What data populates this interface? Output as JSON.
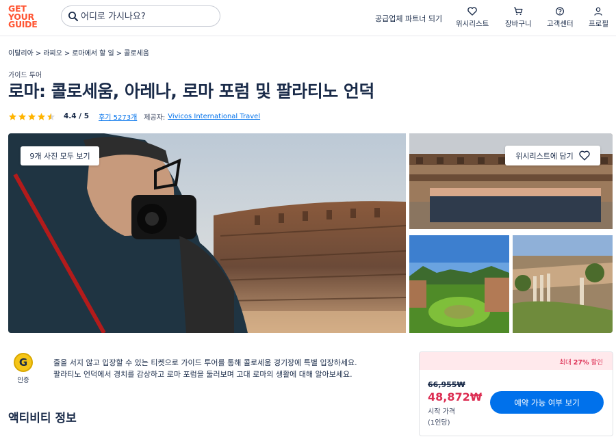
{
  "header": {
    "logo_lines": [
      "GET",
      "YOUR",
      "GUIDE"
    ],
    "search_placeholder": "어디로 가시나요?",
    "partner_link": "공급업체 파트너 되기",
    "nav": [
      {
        "label": "위시리스트",
        "icon": "heart-icon"
      },
      {
        "label": "장바구니",
        "icon": "cart-icon"
      },
      {
        "label": "고객센터",
        "icon": "help-icon"
      },
      {
        "label": "프로필",
        "icon": "user-icon"
      }
    ]
  },
  "breadcrumb": [
    "이탈리아",
    "라찌오",
    "로마에서 할 일",
    "콜로세움"
  ],
  "breadcrumb_separator": ">",
  "product": {
    "category": "가이드 투어",
    "title": "로마: 콜로세움, 아레나, 로마 포럼 및 팔라티노 언덕",
    "rating_value": 4.4,
    "rating_text": "4.4 / 5",
    "reviews_link": "후기 5273개",
    "provider_label": "제공자:",
    "provider_name": "Vivicos International Travel"
  },
  "gallery": {
    "all_photos_label": "9개 사진 모두 보기",
    "wishlist_label": "위시리스트에 담기"
  },
  "badge": {
    "letter": "G",
    "label": "인증"
  },
  "description": [
    "줄을 서지 않고 입장할 수 있는 티켓으로 가이드 투어를 통해 콜로세움 경기장에 특별 입장하세요.",
    "팔라티노 언덕에서 경치를 감상하고 로마 포럼을 둘러보며 고대 로마의 생활에 대해 알아보세요."
  ],
  "section_title": "액티비티 정보",
  "booking": {
    "discount_prefix": "최대",
    "discount_value": "27%",
    "discount_suffix": "할인",
    "original_price": "66,955₩",
    "price": "48,872₩",
    "from_label": "시작 가격",
    "per_person": "(1인당)",
    "cta": "예약 가능 여부 보기"
  },
  "colors": {
    "brand": "#ff5533",
    "primary_blue": "#0071eb",
    "price_red": "#dc2d52",
    "star": "#ffb400",
    "text": "#1a2b49"
  }
}
